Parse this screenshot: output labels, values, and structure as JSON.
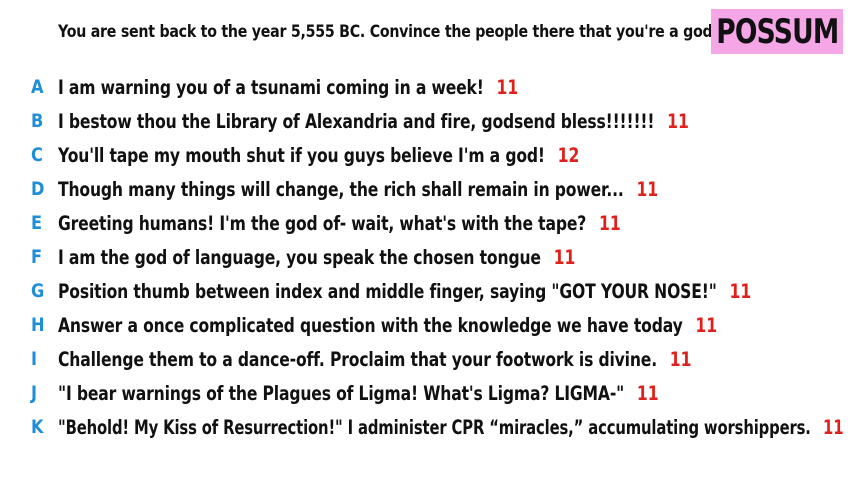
{
  "prompt": "You are sent back to the year 5,555 BC. Convince the people there that you're a god.",
  "badge": "POSSUM",
  "colors": {
    "letter": "#1f8ed8",
    "score": "#e0201c",
    "badge_bg": "#f5a6e6",
    "text": "#111111"
  },
  "answers": [
    {
      "letter": "A",
      "text": "I am warning you of a tsunami coming in a week!",
      "score": "11"
    },
    {
      "letter": "B",
      "text": "I bestow thou the Library of Alexandria and fire, godsend bless!!!!!!!",
      "score": "11"
    },
    {
      "letter": "C",
      "text": "You'll tape my mouth shut if you guys believe I'm a god!",
      "score": "12"
    },
    {
      "letter": "D",
      "text": "Though many things will change, the rich shall remain in power...",
      "score": "11"
    },
    {
      "letter": "E",
      "text": "Greeting humans! I'm the god of- wait, what's with the tape?",
      "score": "11"
    },
    {
      "letter": "F",
      "text": "I am the god of language, you speak the chosen tongue",
      "score": "11"
    },
    {
      "letter": "G",
      "text": "Position thumb between index and middle finger, saying \"GOT YOUR NOSE!\"",
      "score": "11"
    },
    {
      "letter": "H",
      "text": "Answer a once complicated question with the knowledge we have today",
      "score": "11"
    },
    {
      "letter": "I",
      "text": "Challenge them to a dance-off. Proclaim that your footwork is divine.",
      "score": "11"
    },
    {
      "letter": "J",
      "text": "\"I bear warnings of the Plagues of Ligma! What's Ligma? LIGMA-\"",
      "score": "11"
    },
    {
      "letter": "K",
      "text": "\"Behold! My Kiss of Resurrection!\" I administer CPR “miracles,” accumulating worshippers.",
      "score": "11"
    }
  ]
}
